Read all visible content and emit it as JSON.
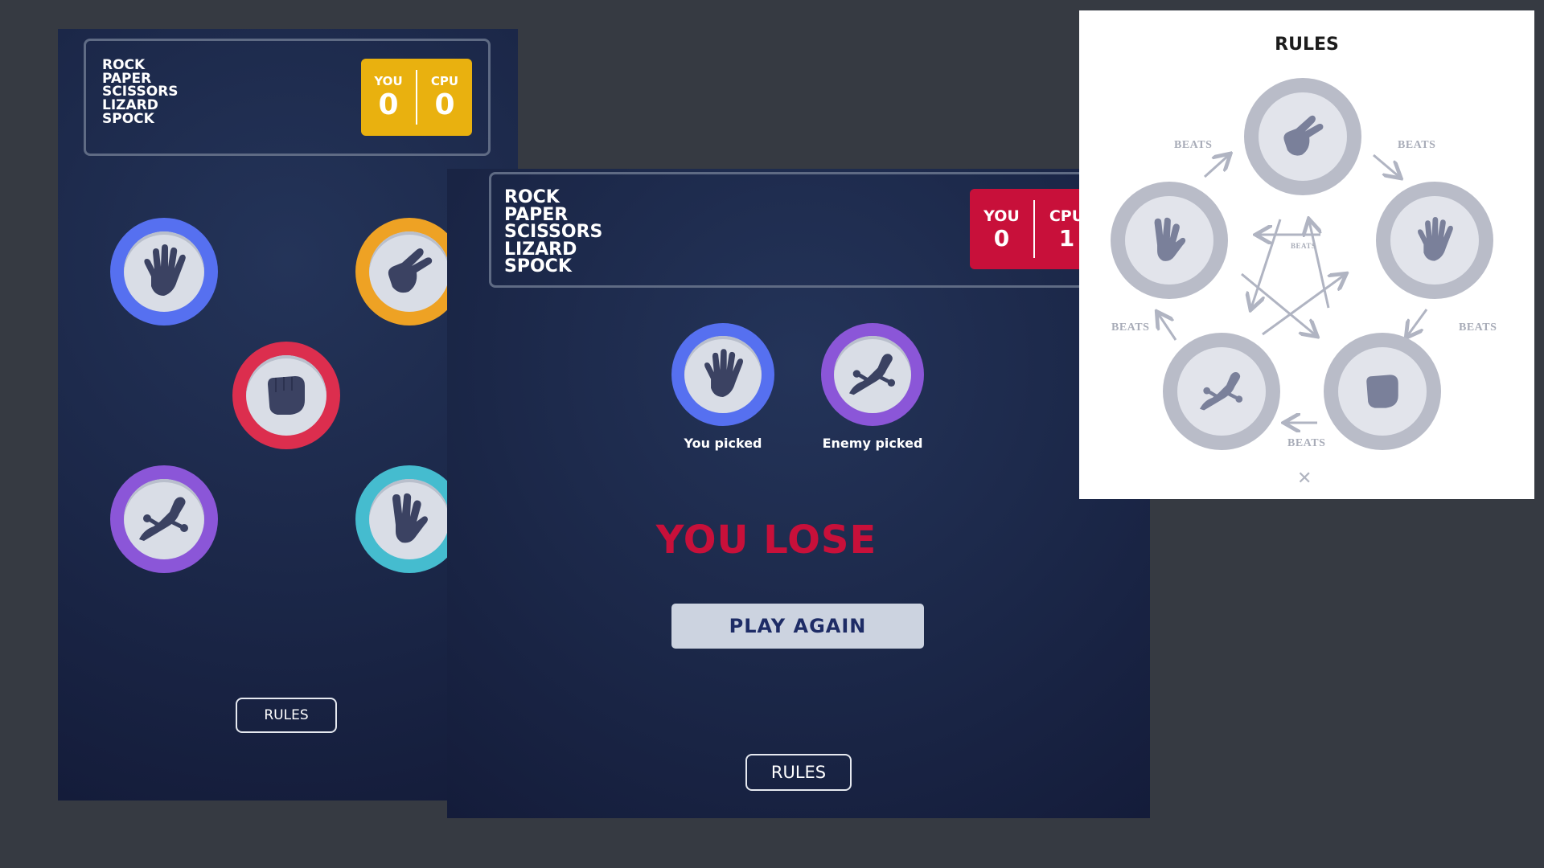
{
  "game_title_lines": [
    "ROCK",
    "PAPER",
    "SCISSORS",
    "LIZARD",
    "SPOCK"
  ],
  "selection_screen": {
    "score": {
      "you_label": "YOU",
      "you_value": "0",
      "cpu_label": "CPU",
      "cpu_value": "0",
      "color": "#e9b10f"
    },
    "tokens": [
      {
        "name": "paper",
        "color": "#5670f0"
      },
      {
        "name": "scissors",
        "color": "#eea224"
      },
      {
        "name": "rock",
        "color": "#dc2e4e"
      },
      {
        "name": "lizard",
        "color": "#8b56d8"
      },
      {
        "name": "spock",
        "color": "#45bccf"
      }
    ],
    "rules_button": "RULES"
  },
  "result_screen": {
    "score": {
      "you_label": "YOU",
      "you_value": "0",
      "cpu_label": "CPU",
      "cpu_value": "1",
      "color": "#c8103a"
    },
    "you_picked": {
      "label": "You picked",
      "choice": "paper",
      "color": "#5670f0"
    },
    "enemy_picked": {
      "label": "Enemy picked",
      "choice": "lizard",
      "color": "#8b56d8"
    },
    "result_text": "YOU LOSE",
    "play_again": "PLAY AGAIN",
    "rules_button": "RULES"
  },
  "rules_modal": {
    "title": "RULES",
    "beats_label": "BEATS",
    "close_icon": "close-icon",
    "choices": [
      "scissors",
      "paper",
      "rock",
      "lizard",
      "spock"
    ]
  }
}
